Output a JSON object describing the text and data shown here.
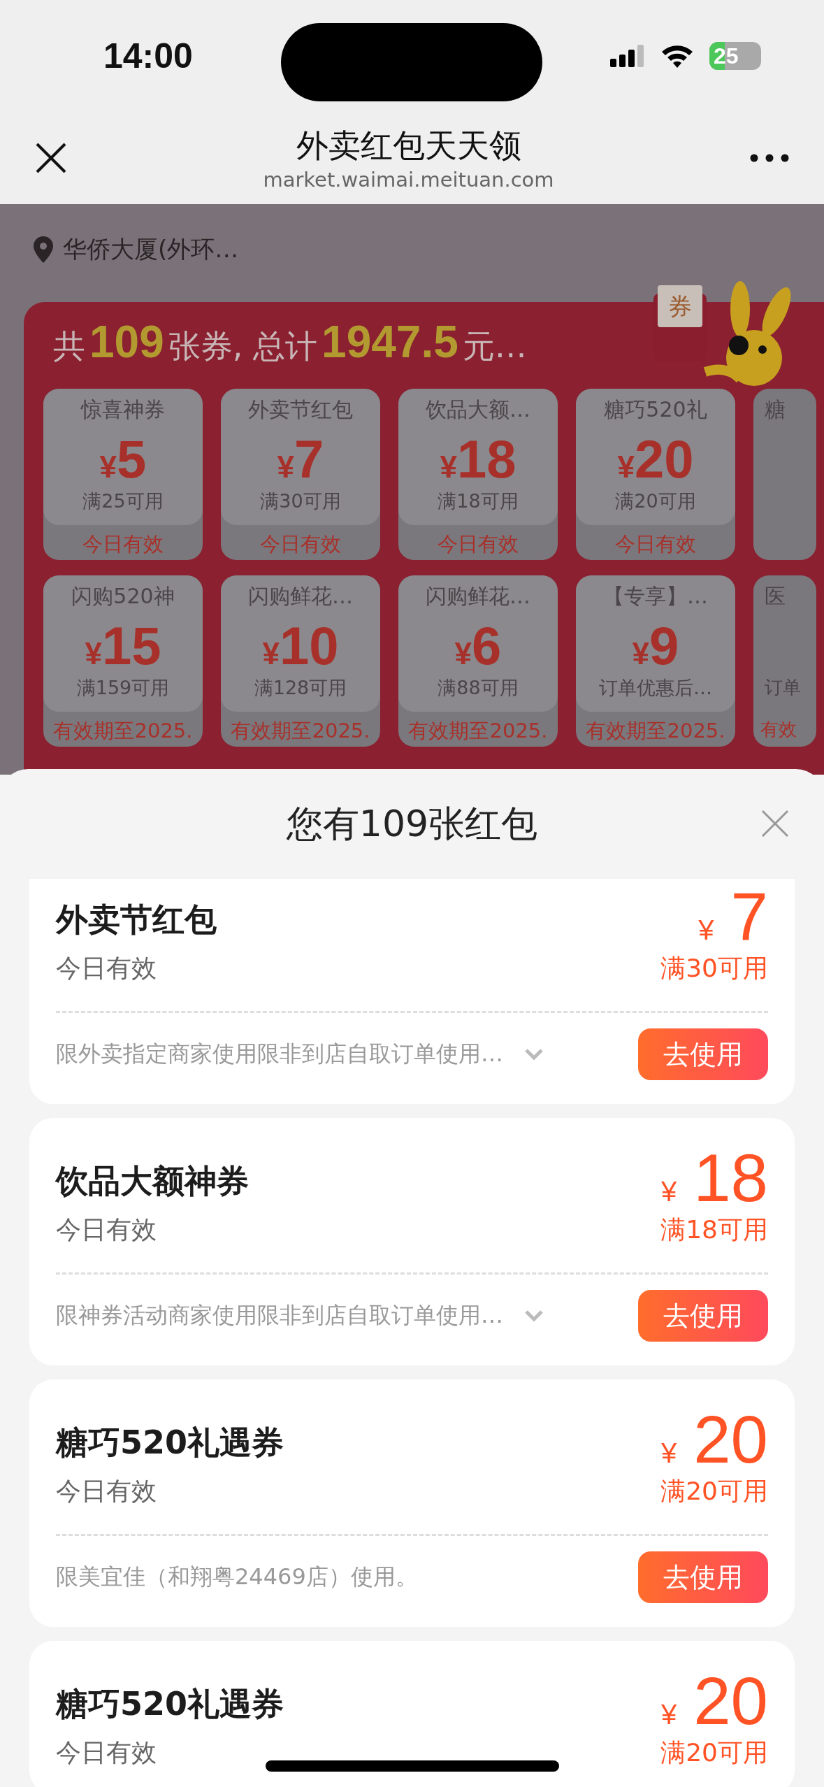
{
  "status_bar": {
    "time": "14:00",
    "battery": "25"
  },
  "nav": {
    "title": "外卖红包天天领",
    "url": "market.waimai.meituan.com"
  },
  "location": "华侨大厦(外环…",
  "summary": {
    "prefix": "共",
    "count": "109",
    "middle": "张券, 总计",
    "total": "1947.5",
    "suffix": "元…",
    "envelope_label": "券"
  },
  "coupon_rows": [
    [
      {
        "name": "惊喜神券",
        "currency": "¥",
        "amount": "5",
        "condition": "满25可用",
        "validity": "今日有效"
      },
      {
        "name": "外卖节红包",
        "currency": "¥",
        "amount": "7",
        "condition": "满30可用",
        "validity": "今日有效"
      },
      {
        "name": "饮品大额…",
        "currency": "¥",
        "amount": "18",
        "condition": "满18可用",
        "validity": "今日有效"
      },
      {
        "name": "糖巧520礼",
        "currency": "¥",
        "amount": "20",
        "condition": "满20可用",
        "validity": "今日有效"
      },
      {
        "name": "糖"
      }
    ],
    [
      {
        "name": "闪购520神",
        "currency": "¥",
        "amount": "15",
        "condition": "满159可用",
        "validity": "有效期至2025."
      },
      {
        "name": "闪购鲜花…",
        "currency": "¥",
        "amount": "10",
        "condition": "满128可用",
        "validity": "有效期至2025."
      },
      {
        "name": "闪购鲜花…",
        "currency": "¥",
        "amount": "6",
        "condition": "满88可用",
        "validity": "有效期至2025."
      },
      {
        "name": "【专享】…",
        "currency": "¥",
        "amount": "9",
        "condition": "订单优惠后…",
        "validity": "有效期至2025."
      },
      {
        "name": "医",
        "condition": "订单",
        "validity": "有效"
      }
    ]
  ],
  "sheet": {
    "title": "您有109张红包",
    "items": [
      {
        "title": "外卖节红包",
        "validity": "今日有效",
        "currency": "¥",
        "amount": "7",
        "condition": "满30可用",
        "rule": "限外卖指定商家使用限非到店自取订单使用…",
        "expandable": true,
        "button": "去使用"
      },
      {
        "title": "饮品大额神券",
        "validity": "今日有效",
        "currency": "¥",
        "amount": "18",
        "condition": "满18可用",
        "rule": "限神券活动商家使用限非到店自取订单使用…",
        "expandable": true,
        "button": "去使用"
      },
      {
        "title": "糖巧520礼遇券",
        "validity": "今日有效",
        "currency": "¥",
        "amount": "20",
        "condition": "满20可用",
        "rule": "限美宜佳（和翔粤24469店）使用。",
        "expandable": false,
        "button": "去使用"
      },
      {
        "title": "糖巧520礼遇券",
        "validity": "今日有效",
        "currency": "¥",
        "amount": "20",
        "condition": "满20可用"
      }
    ]
  }
}
